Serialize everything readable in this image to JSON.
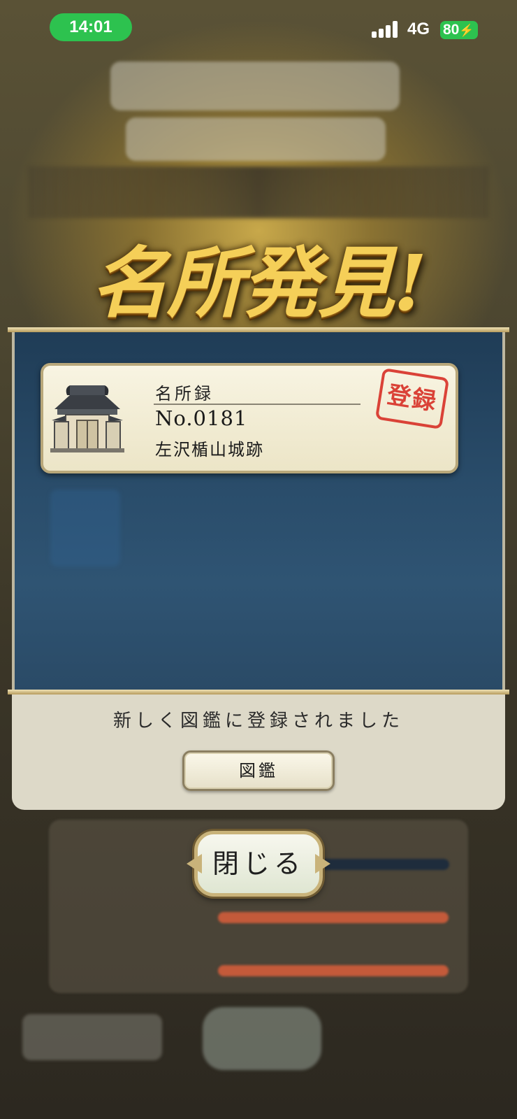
{
  "status_bar": {
    "time": "14:01",
    "network": "4G",
    "battery": "80"
  },
  "title": "名所発見!",
  "record": {
    "label": "名所録",
    "number": "No.0181",
    "name": "左沢楯山城跡",
    "stamp": "登録",
    "icon": "castle-gate-icon"
  },
  "message": "新しく図鑑に登録されました",
  "buttons": {
    "zukan": "図鑑",
    "close": "閉じる"
  },
  "colors": {
    "title_gold": "#f5cf58",
    "panel_blue": "#2a4d6b",
    "stamp_red": "#d8342a",
    "status_green": "#2dc24f"
  }
}
